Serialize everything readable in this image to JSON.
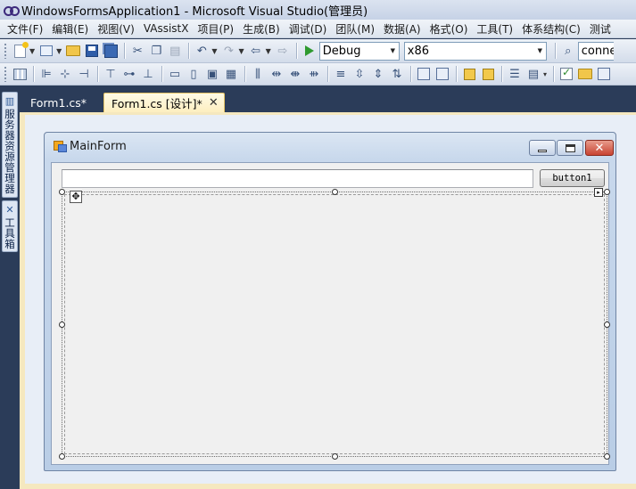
{
  "window": {
    "title": "WindowsFormsApplication1 - Microsoft Visual Studio(管理员)"
  },
  "menu": {
    "items": [
      "文件(F)",
      "编辑(E)",
      "视图(V)",
      "VAssistX",
      "项目(P)",
      "生成(B)",
      "调试(D)",
      "团队(M)",
      "数据(A)",
      "格式(O)",
      "工具(T)",
      "体系结构(C)",
      "测试"
    ]
  },
  "toolbar": {
    "configuration": "Debug",
    "platform": "x86",
    "find_text": "conne"
  },
  "side_panels": {
    "server_explorer": "服务器资源管理器",
    "toolbox": "工具箱"
  },
  "doc_tabs": {
    "code_tab": "Form1.cs*",
    "design_tab": "Form1.cs [设计]*",
    "close_glyph": "✕"
  },
  "form": {
    "title": "MainForm",
    "textbox_value": "",
    "button_label": "button1"
  },
  "icons": {
    "titlebar": "vs-logo-icon",
    "form": "form-icon",
    "move": "move-handle-icon",
    "smart_tag": "smart-tag-icon"
  },
  "colors": {
    "ide_background": "#2b3c59",
    "designer_background": "#f5e8bf",
    "active_tab": "#fdeec0",
    "form_client": "#f0f0f0"
  }
}
